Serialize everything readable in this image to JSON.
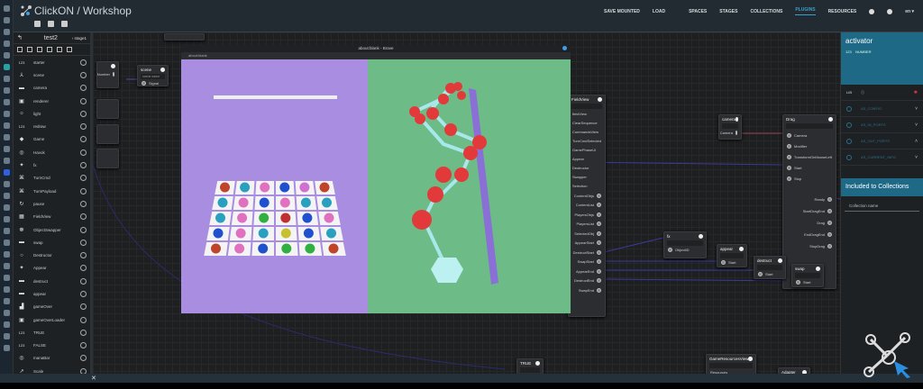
{
  "header": {
    "title": "ClickON / Workshop",
    "nav": [
      "SAVE MOUNTED",
      "LOAD",
      "SPACES",
      "STAGES",
      "COLLECTIONS",
      "PLUGINS",
      "RESOURCES"
    ],
    "active_nav": "PLUGINS",
    "lang": "en"
  },
  "sidebar": {
    "back_icon": "undo-icon",
    "project": "test2",
    "stage": "stage1",
    "items": [
      {
        "icon": "123",
        "label": "starter"
      },
      {
        "icon": "⅄",
        "label": "scene"
      },
      {
        "icon": "▬",
        "label": "camera"
      },
      {
        "icon": "▣",
        "label": "renderer"
      },
      {
        "icon": "☼",
        "label": "light"
      },
      {
        "icon": "123",
        "label": "redraw"
      },
      {
        "icon": "◆",
        "label": "Game"
      },
      {
        "icon": "◎",
        "label": "Havok"
      },
      {
        "icon": "✦",
        "label": "fx"
      },
      {
        "icon": "⌘",
        "label": "TurnCmd"
      },
      {
        "icon": "⌘",
        "label": "TurnPayload"
      },
      {
        "icon": "↻",
        "label": "pause"
      },
      {
        "icon": "▦",
        "label": "FieldView"
      },
      {
        "icon": "☸",
        "label": "ObjectSwapper"
      },
      {
        "icon": "▬",
        "label": "swap"
      },
      {
        "icon": "○",
        "label": "Destructor"
      },
      {
        "icon": "✦",
        "label": "Appear"
      },
      {
        "icon": "▬",
        "label": "destruct"
      },
      {
        "icon": "▬",
        "label": "appear"
      },
      {
        "icon": "▟",
        "label": "gameOver"
      },
      {
        "icon": "▣",
        "label": "gameOverLoader"
      },
      {
        "icon": "123",
        "label": "TRUE"
      },
      {
        "icon": "123",
        "label": "FALSE"
      },
      {
        "icon": "◎",
        "label": "manaBar"
      },
      {
        "icon": "↗",
        "label": "Scale"
      }
    ]
  },
  "right_panel": {
    "title": "activator",
    "type_icon": "123",
    "type": "NUMBER",
    "lib": "LIB",
    "sections": [
      "AS_CONFIG",
      "AS_IN_PORTS",
      "AS_OUT_PORTS",
      "AS_CURRENT_INFO"
    ],
    "collections_title": "Included to Collections",
    "collection_name_label": "Collection name"
  },
  "browser": {
    "title": "about:blank - Brave",
    "address": "about:blank"
  },
  "nodes": {
    "scene": {
      "title": "scene",
      "sub": "scene name",
      "port": "Signal"
    },
    "starter": {
      "port": "Number"
    },
    "fieldview": {
      "title": "FieldView",
      "props": [
        "fieldView",
        "ClearSequence",
        "CommandsView",
        "TurnCmdSelected",
        "GamePhaseUI",
        "Appear",
        "Destructor",
        "Swapper",
        "Selection"
      ],
      "outputs": [
        "ContentObjs",
        "ContentList",
        "PlayersObjs",
        "PlayersList",
        "SelectedObj",
        "AppearStart",
        "DestructStart",
        "SwapStart",
        "AppearEnd",
        "DestructEnd",
        "SwapEnd"
      ]
    },
    "camera": {
      "title": "camera",
      "port": "Camera"
    },
    "drag": {
      "title": "Drag",
      "inputs": [
        "Camera",
        "Modifier",
        "TransformOnMouseLeft",
        "Start",
        "Stop"
      ],
      "outputs": [
        "Ready",
        "StartDragEnd",
        "Drag",
        "EndDragEnd",
        "StopDrag"
      ]
    },
    "fx": {
      "title": "fx",
      "port": "ObjectID"
    },
    "appear": {
      "title": "appear",
      "port": "Start"
    },
    "destruct": {
      "title": "destruct",
      "port": "Start"
    },
    "swap": {
      "title": "swap",
      "port": "Start"
    },
    "true": {
      "title": "TRUE"
    },
    "grv": {
      "title": "GameResourcesView",
      "port": "Resources"
    },
    "adapter": {
      "title": "Adapter"
    }
  }
}
